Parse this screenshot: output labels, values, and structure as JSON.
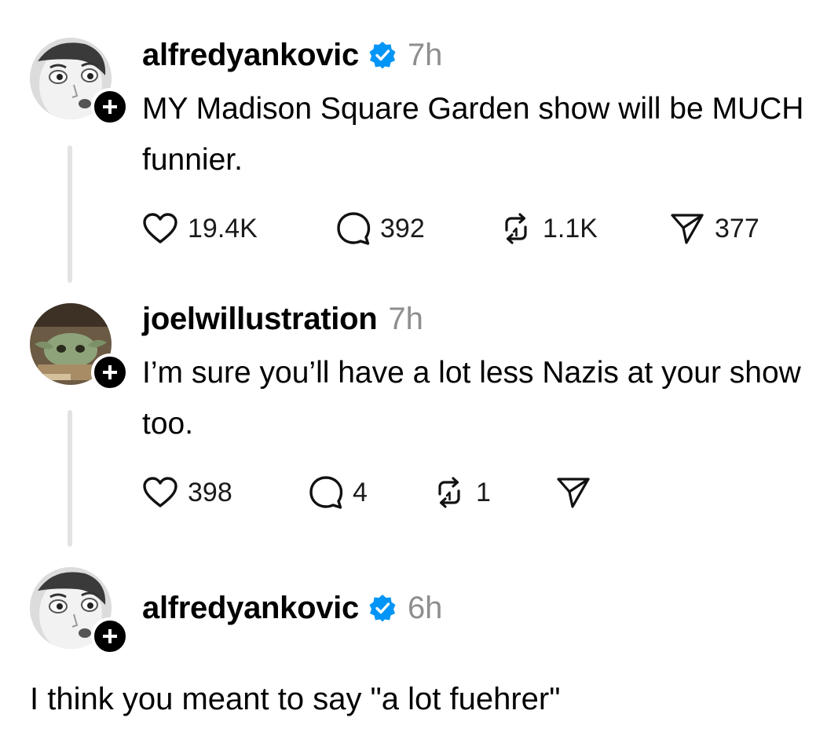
{
  "posts": [
    {
      "username": "alfredyankovic",
      "verified": true,
      "time": "7h",
      "text": "MY Madison Square Garden show will be MUCH funnier.",
      "likes": "19.4K",
      "replies": "392",
      "reposts": "1.1K",
      "shares": "377"
    },
    {
      "username": "joelwillustration",
      "verified": false,
      "time": "7h",
      "text": "I’m sure you’ll have a lot less Nazis at your show too.",
      "likes": "398",
      "replies": "4",
      "reposts": "1",
      "shares": ""
    },
    {
      "username": "alfredyankovic",
      "verified": true,
      "time": "6h",
      "text": "I think you meant to say \"a lot fuehrer\""
    }
  ],
  "icons": {
    "like": "heart-icon",
    "reply": "comment-bubble-icon",
    "repost": "repost-arrows-icon",
    "share": "send-paper-plane-icon",
    "verified": "verified-badge-icon",
    "follow": "plus-icon"
  },
  "colors": {
    "verified": "#0095f6",
    "muted": "#8e8e8e",
    "thread_line": "#e3e3e3"
  }
}
